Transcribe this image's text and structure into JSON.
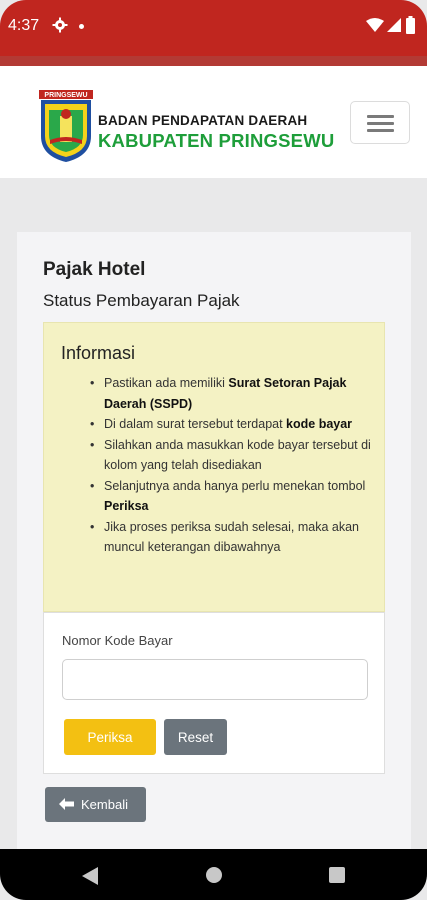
{
  "status_bar": {
    "time": "4:37",
    "icons": [
      "gear-icon",
      "notification-dot",
      "wifi-icon",
      "signal-icon",
      "battery-icon"
    ]
  },
  "header": {
    "logo_text": "PRINGSEWU",
    "org_line1": "BADAN PENDAPATAN DAERAH",
    "org_line2": "KABUPATEN PRINGSEWU",
    "menu_icon": "hamburger-icon"
  },
  "page": {
    "title": "Pajak Hotel",
    "subtitle": "Status Pembayaran Pajak"
  },
  "info": {
    "heading": "Informasi",
    "items": [
      {
        "before": "Pastikan ada memiliki ",
        "bold": "Surat Setoran Pajak Daerah (SSPD)",
        "after": ""
      },
      {
        "before": "Di dalam surat tersebut terdapat ",
        "bold": "kode bayar",
        "after": ""
      },
      {
        "before": "Silahkan anda masukkan kode bayar tersebut di kolom yang telah disediakan",
        "bold": "",
        "after": ""
      },
      {
        "before": "Selanjutnya anda hanya perlu menekan tombol ",
        "bold": "Periksa",
        "after": ""
      },
      {
        "before": "Jika proses periksa sudah selesai, maka akan muncul keterangan dibawahnya",
        "bold": "",
        "after": ""
      }
    ]
  },
  "form": {
    "label": "Nomor Kode Bayar",
    "value": "",
    "placeholder": "",
    "submit_label": "Periksa",
    "reset_label": "Reset"
  },
  "back_button": {
    "label": "Kembali",
    "icon": "arrow-left-icon"
  },
  "colors": {
    "status_bar": "#c0261f",
    "brand_green": "#1e9e3a",
    "info_bg": "#f4f2c4",
    "submit": "#f3c012",
    "secondary": "#6b747c"
  }
}
